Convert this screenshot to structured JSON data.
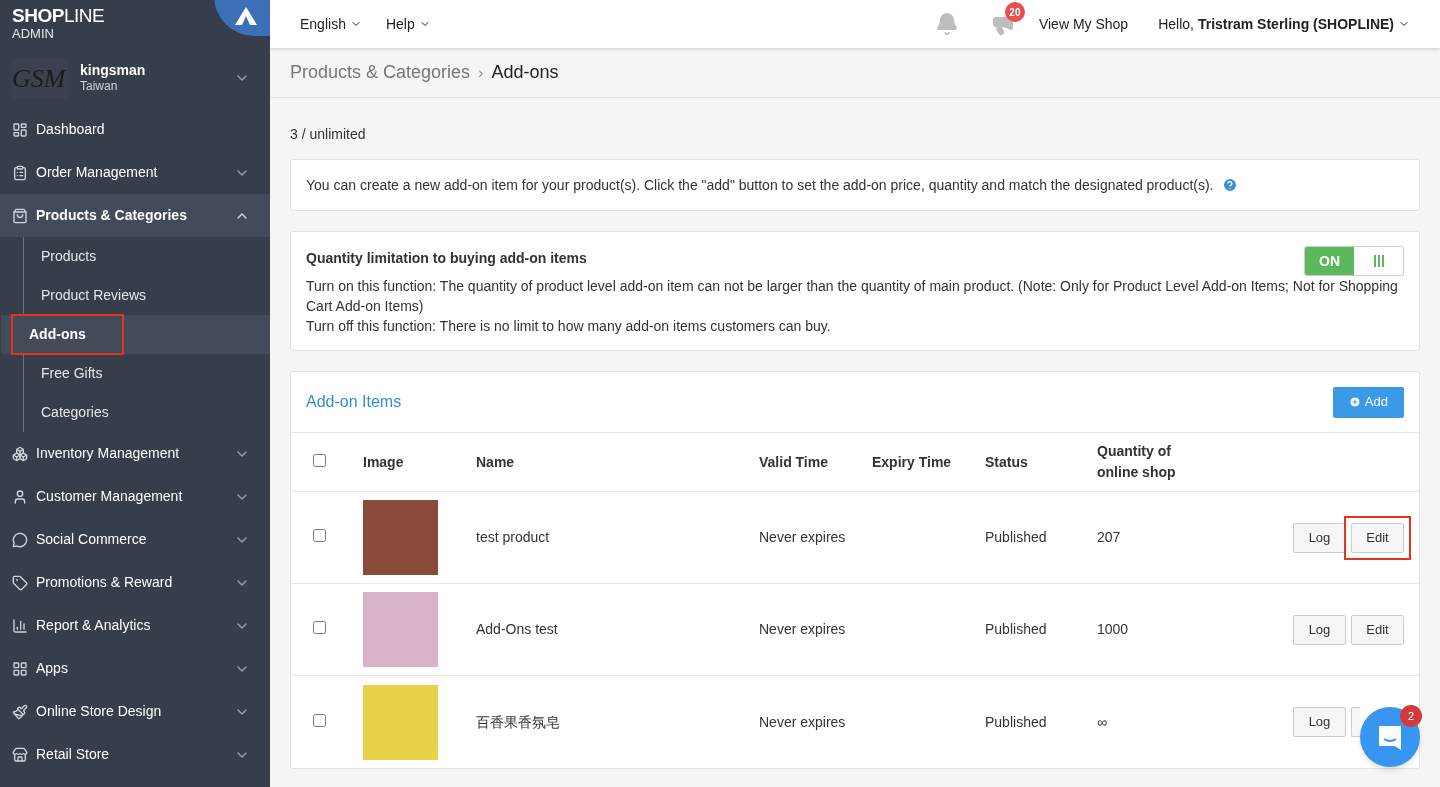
{
  "brand": {
    "name_bold": "SHOP",
    "name_light": "LINE",
    "sub": "ADMIN"
  },
  "store": {
    "logo_text": "GSM",
    "name": "kingsman",
    "region": "Taiwan"
  },
  "sidebar": {
    "items": [
      {
        "kind": "link",
        "label": "Dashboard",
        "selected": false
      },
      {
        "kind": "group",
        "label": "Order Management",
        "selected": false,
        "expanded": false
      },
      {
        "kind": "group",
        "label": "Products & Categories",
        "selected": true,
        "expanded": true,
        "children": [
          {
            "label": "Products",
            "selected": false,
            "highlighted": false
          },
          {
            "label": "Product Reviews",
            "selected": false,
            "highlighted": false
          },
          {
            "label": "Add-ons",
            "selected": true,
            "highlighted": true
          },
          {
            "label": "Free Gifts",
            "selected": false,
            "highlighted": false
          },
          {
            "label": "Categories",
            "selected": false,
            "highlighted": false
          }
        ]
      },
      {
        "kind": "group",
        "label": "Inventory Management",
        "selected": false,
        "expanded": false
      },
      {
        "kind": "group",
        "label": "Customer Management",
        "selected": false,
        "expanded": false
      },
      {
        "kind": "group",
        "label": "Social Commerce",
        "selected": false,
        "expanded": false
      },
      {
        "kind": "group",
        "label": "Promotions & Reward",
        "selected": false,
        "expanded": false
      },
      {
        "kind": "group",
        "label": "Report & Analytics",
        "selected": false,
        "expanded": false
      },
      {
        "kind": "group",
        "label": "Apps",
        "selected": false,
        "expanded": false
      },
      {
        "kind": "group",
        "label": "Online Store Design",
        "selected": false,
        "expanded": false
      },
      {
        "kind": "group",
        "label": "Retail Store",
        "selected": false,
        "expanded": false
      }
    ]
  },
  "topbar": {
    "menus": [
      "English",
      "Help"
    ],
    "announcement_badge": "20",
    "view_shop": "View My Shop",
    "greeting": "Hello,",
    "user": "Tristram Sterling (SHOPLINE)"
  },
  "breadcrumb": {
    "parent": "Products & Categories",
    "separator": "›",
    "current": "Add-ons"
  },
  "quota": "3 / unlimited",
  "info": "You can create a new add-on item for your product(s). Click the \"add\" button to set the add-on price, quantity and match the designated product(s).",
  "limitation": {
    "title": "Quantity limitation to buying add-on items",
    "on": true,
    "on_label": "ON",
    "lines": [
      "Turn on this function: The quantity of product level add-on item can not be larger than the quantity of main product. (Note: Only for Product Level Add-on Items; Not for Shopping Cart Add-on Items)",
      "Turn off this function: There is no limit to how many add-on items customers can buy."
    ]
  },
  "table": {
    "title": "Add-on Items",
    "add_button": "Add",
    "select_all_checked": false,
    "columns": [
      "Image",
      "Name",
      "Valid Time",
      "Expiry Time",
      "Status",
      "Quantity of online shop"
    ],
    "rows": [
      {
        "checked": false,
        "name": "test product",
        "valid": "Never expires",
        "status": "Published",
        "quantity": "207",
        "log": "Log",
        "edit": "Edit",
        "edit_highlighted": true
      },
      {
        "checked": false,
        "name": "Add-Ons test",
        "valid": "Never expires",
        "status": "Published",
        "quantity": "1000",
        "log": "Log",
        "edit": "Edit",
        "edit_highlighted": false
      },
      {
        "checked": false,
        "name": "百香果香氛皂",
        "valid": "Never expires",
        "status": "Published",
        "quantity": "∞",
        "log": "Log"
      }
    ]
  },
  "chat": {
    "badge": "2"
  }
}
